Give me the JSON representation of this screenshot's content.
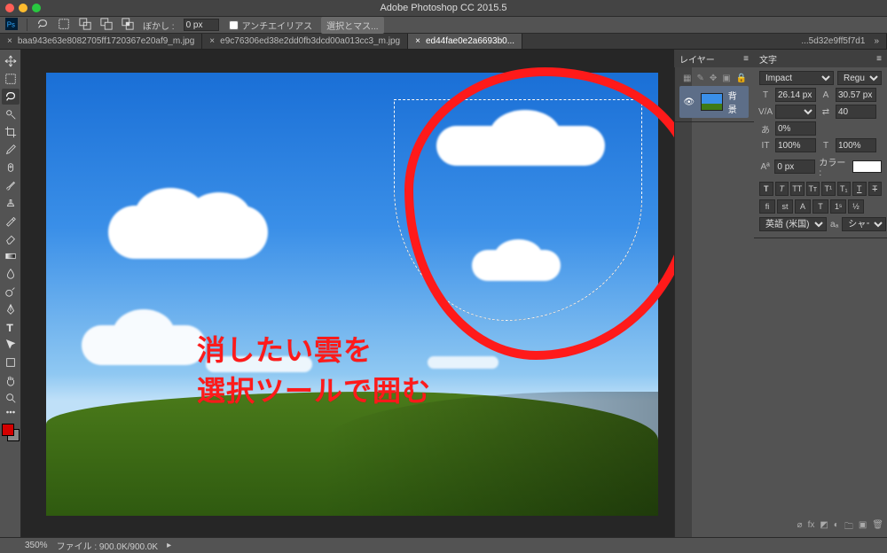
{
  "app_title": "Adobe Photoshop CC 2015.5",
  "options_bar": {
    "feather_label": "ぼかし : ",
    "feather_value": "0 px",
    "antialias_label": "アンチエイリアス",
    "select_mask_label": "選択とマス..."
  },
  "tabs": [
    {
      "label": "baa943e63e8082705ff1720367e20af9_m.jpg",
      "active": false
    },
    {
      "label": "e9c76306ed38e2dd0fb3dcd00a013cc3_m.jpg",
      "active": false
    },
    {
      "label": "ed44fae0e2a6693b0...",
      "active": true
    },
    {
      "label": "...5d32e9ff5f7d1",
      "active": false
    }
  ],
  "annotation": {
    "line1": "消したい雲を",
    "line2": "選択ツールで囲む"
  },
  "layers_panel": {
    "title": "レイヤー",
    "layer_name": "背景"
  },
  "char_panel": {
    "title": "文字",
    "font_family": "Impact",
    "font_style": "Regular",
    "font_size": "26.14 px",
    "leading": "30.57 px",
    "tracking_va": "V/A",
    "tracking_value": "40",
    "baseline_shift": "0%",
    "vert_scale": "100%",
    "horz_scale": "100%",
    "baseline_px": "0 px",
    "color_label": "カラー :",
    "lang": "英語 (米国)",
    "aa": "シャープ"
  },
  "status": {
    "zoom": "350%",
    "doc_label": "ファイル :",
    "doc_size": "900.0K/900.0K"
  }
}
